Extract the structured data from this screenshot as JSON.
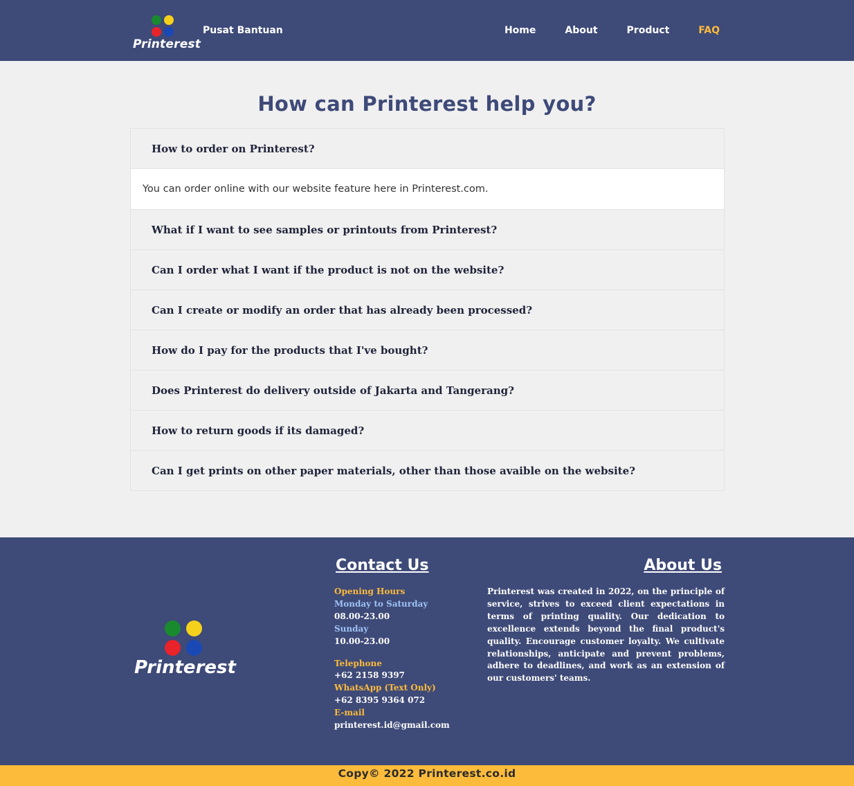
{
  "header": {
    "logo_text": "Printerest",
    "brand_subtitle": "Pusat Bantuan",
    "nav": [
      "Home",
      "About",
      "Product",
      "FAQ"
    ],
    "active_nav": "FAQ",
    "accent_color": "#fdbb3b",
    "bg_color": "#3e4a78"
  },
  "main": {
    "title": "How can Printerest help you?",
    "faq": [
      {
        "question": "How to order on Printerest?",
        "answer": "You can order online with our website feature here in Printerest.com.",
        "expanded": true
      },
      {
        "question": "What if I want to see samples or printouts from Printerest?"
      },
      {
        "question": "Can I order what I want if the product is not on the website?"
      },
      {
        "question": "Can I create or modify an order that has already been processed?"
      },
      {
        "question": "How do I pay for the products that I've bought?"
      },
      {
        "question": "Does Printerest do delivery outside of Jakarta and Tangerang?"
      },
      {
        "question": "How to return goods if its damaged?"
      },
      {
        "question": "Can I get prints on other paper materials, other than those avaible on the website?"
      }
    ]
  },
  "footer": {
    "logo_text": "Printerest",
    "contact": {
      "title": "Contact Us",
      "opening_hours_label": "Opening Hours",
      "weekday_label": "Monday to Saturday",
      "weekday_hours": "08.00-23.00",
      "sunday_label": "Sunday",
      "sunday_hours": "10.00-23.00",
      "telephone_label": "Telephone",
      "telephone": "+62 2158 9397",
      "whatsapp_label": "WhatsApp (Text Only)",
      "whatsapp": "+62 8395 9364 072",
      "email_label": "E-mail",
      "email": "printerest.id@gmail.com"
    },
    "about": {
      "title": "About Us",
      "text": "Printerest was created in 2022, on the principle of service, strives to exceed client expectations in terms of printing quality. Our dedication to excellence extends beyond the final product's quality. Encourage customer loyalty. We cultivate relationships, anticipate and prevent problems, adhere to deadlines, and work as an extension of our customers' teams."
    },
    "copyright": "Copy© 2022 Printerest.co.id"
  }
}
